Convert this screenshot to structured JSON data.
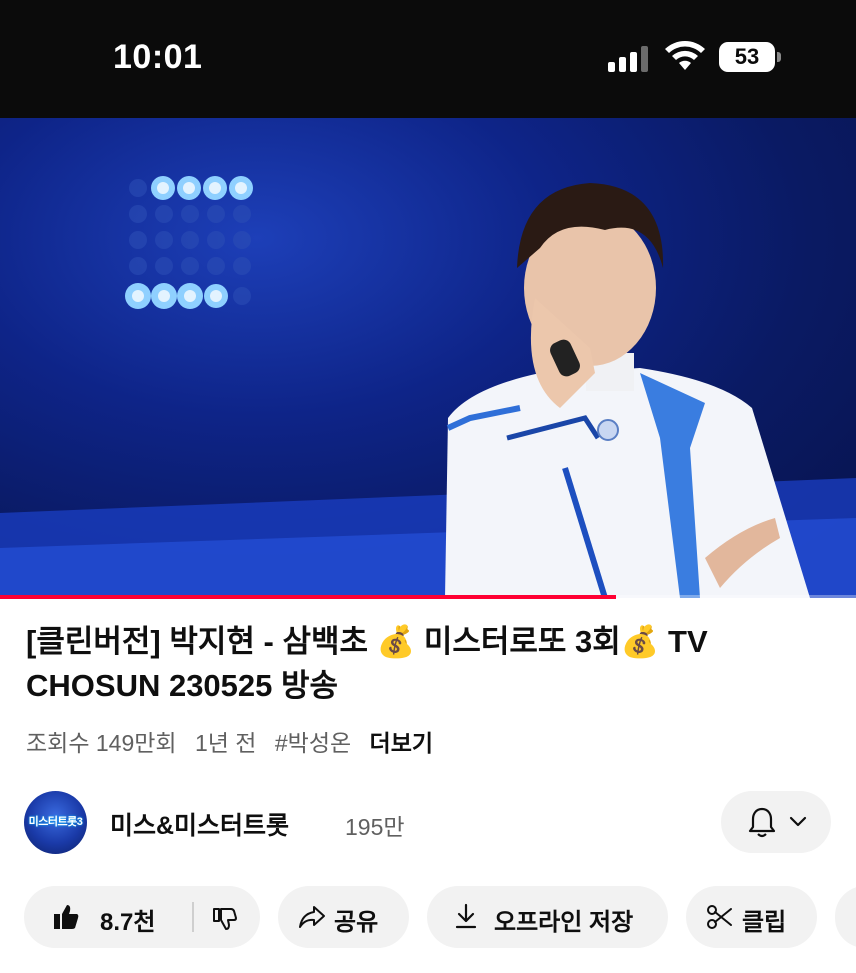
{
  "status_bar": {
    "time": "10:01",
    "battery": "53",
    "icons": [
      "cellular-signal-icon",
      "wifi-icon",
      "battery-icon"
    ]
  },
  "video": {
    "progress_fraction": 0.72,
    "progress_color": "#ff0033"
  },
  "title": "[클린버전] 박지현 - 삼백초 💰 미스터로또 3회💰 TV CHOSUN 230525 방송",
  "meta": {
    "views": "조회수 149만회",
    "age": "1년 전",
    "hashtag": "#박성온",
    "more": "더보기"
  },
  "channel": {
    "name": "미스&미스터트롯",
    "subscribers": "195만",
    "avatar_text": "미스터트롯3",
    "bell_icon": "bell-icon",
    "dropdown_icon": "chevron-down-icon"
  },
  "actions": {
    "like_count": "8.7천",
    "share": "공유",
    "download": "오프라인 저장",
    "clip": "클립",
    "icons": [
      "thumbs-up-icon",
      "thumbs-down-icon",
      "share-icon",
      "download-icon",
      "scissors-icon"
    ]
  },
  "colors": {
    "status_bar_bg": "#0b0b0b",
    "pill_bg": "#f2f2f2",
    "secondary_text": "#606060"
  }
}
